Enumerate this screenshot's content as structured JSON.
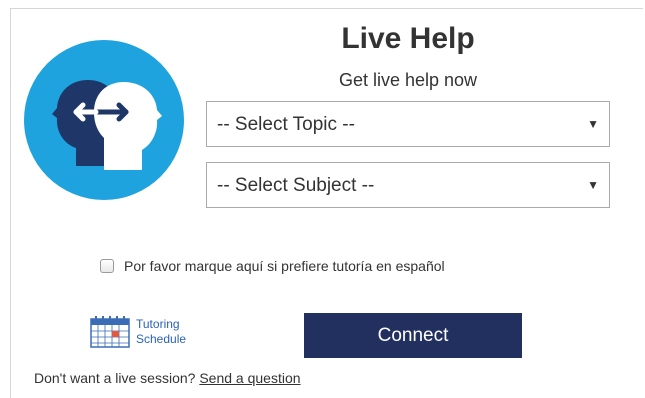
{
  "header": {
    "title": "Live Help",
    "subtitle": "Get live help now"
  },
  "logo": {
    "icon": "two-heads-exchange-icon",
    "circle_color": "#1fa3df",
    "back_head_color": "#1e3668",
    "front_head_color": "#ffffff"
  },
  "form": {
    "topic_select": {
      "selected": "-- Select Topic --",
      "caret": "▼"
    },
    "subject_select": {
      "selected": "-- Select Subject --",
      "caret": "▼"
    },
    "spanish_checkbox": {
      "label": "Por favor marque aquí si prefiere tutoría en español",
      "checked": false
    }
  },
  "schedule_link": {
    "icon": "calendar-icon",
    "line1": "Tutoring",
    "line2": "Schedule"
  },
  "connect_button": {
    "label": "Connect",
    "color": "#223060"
  },
  "footer": {
    "text": "Don't want a live session?",
    "link": "Send a question"
  }
}
